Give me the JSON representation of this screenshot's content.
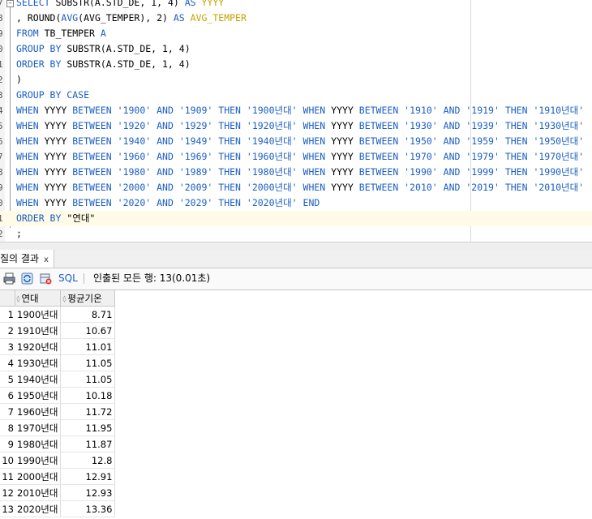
{
  "editor": {
    "lines": [
      {
        "ln": "7",
        "tokens": [
          [
            "kw",
            "SELECT "
          ],
          [
            "fn",
            "SUBSTR(A.STD_DE, 1, 4) "
          ],
          [
            "kw",
            "AS "
          ],
          [
            "alias",
            "YYYY"
          ]
        ]
      },
      {
        "ln": "8",
        "tokens": [
          [
            "ident",
            ", ROUND("
          ],
          [
            "kw",
            "AVG"
          ],
          [
            "ident",
            "(AVG_TEMPER), 2) "
          ],
          [
            "kw",
            "AS "
          ],
          [
            "alias",
            "AVG_TEMPER"
          ]
        ]
      },
      {
        "ln": "9",
        "tokens": [
          [
            "kw",
            "FROM "
          ],
          [
            "ident",
            "TB_TEMPER "
          ],
          [
            "kw",
            "A"
          ]
        ]
      },
      {
        "ln": "0",
        "tokens": [
          [
            "kw",
            "GROUP BY "
          ],
          [
            "ident",
            "SUBSTR(A.STD_DE, 1, 4)"
          ]
        ]
      },
      {
        "ln": "1",
        "tokens": [
          [
            "kw",
            "ORDER BY "
          ],
          [
            "ident",
            "SUBSTR(A.STD_DE, 1, 4)"
          ]
        ]
      },
      {
        "ln": "2",
        "tokens": [
          [
            "ident",
            ")"
          ]
        ]
      },
      {
        "ln": "3",
        "tokens": [
          [
            "kw",
            "GROUP BY CASE"
          ]
        ]
      },
      {
        "ln": "4",
        "tokens": [
          [
            "kw",
            "WHEN "
          ],
          [
            "ident",
            "YYYY "
          ],
          [
            "kw",
            "BETWEEN "
          ],
          [
            "str",
            "'1900' "
          ],
          [
            "kw",
            "AND "
          ],
          [
            "str",
            "'1909' "
          ],
          [
            "kw",
            "THEN "
          ],
          [
            "str",
            "'1900년대' "
          ],
          [
            "kw",
            "WHEN "
          ],
          [
            "ident",
            "YYYY "
          ],
          [
            "kw",
            "BETWEEN "
          ],
          [
            "str",
            "'1910' "
          ],
          [
            "kw",
            "AND "
          ],
          [
            "str",
            "'1919' "
          ],
          [
            "kw",
            "THEN "
          ],
          [
            "str",
            "'1910년대'"
          ]
        ]
      },
      {
        "ln": "5",
        "tokens": [
          [
            "kw",
            "WHEN "
          ],
          [
            "ident",
            "YYYY "
          ],
          [
            "kw",
            "BETWEEN "
          ],
          [
            "str",
            "'1920' "
          ],
          [
            "kw",
            "AND "
          ],
          [
            "str",
            "'1929' "
          ],
          [
            "kw",
            "THEN "
          ],
          [
            "str",
            "'1920년대' "
          ],
          [
            "kw",
            "WHEN "
          ],
          [
            "ident",
            "YYYY "
          ],
          [
            "kw",
            "BETWEEN "
          ],
          [
            "str",
            "'1930' "
          ],
          [
            "kw",
            "AND "
          ],
          [
            "str",
            "'1939' "
          ],
          [
            "kw",
            "THEN "
          ],
          [
            "str",
            "'1930년대'"
          ]
        ]
      },
      {
        "ln": "6",
        "tokens": [
          [
            "kw",
            "WHEN "
          ],
          [
            "ident",
            "YYYY "
          ],
          [
            "kw",
            "BETWEEN "
          ],
          [
            "str",
            "'1940' "
          ],
          [
            "kw",
            "AND "
          ],
          [
            "str",
            "'1949' "
          ],
          [
            "kw",
            "THEN "
          ],
          [
            "str",
            "'1940년대' "
          ],
          [
            "kw",
            "WHEN "
          ],
          [
            "ident",
            "YYYY "
          ],
          [
            "kw",
            "BETWEEN "
          ],
          [
            "str",
            "'1950' "
          ],
          [
            "kw",
            "AND "
          ],
          [
            "str",
            "'1959' "
          ],
          [
            "kw",
            "THEN "
          ],
          [
            "str",
            "'1950년대'"
          ]
        ]
      },
      {
        "ln": "7",
        "tokens": [
          [
            "kw",
            "WHEN "
          ],
          [
            "ident",
            "YYYY "
          ],
          [
            "kw",
            "BETWEEN "
          ],
          [
            "str",
            "'1960' "
          ],
          [
            "kw",
            "AND "
          ],
          [
            "str",
            "'1969' "
          ],
          [
            "kw",
            "THEN "
          ],
          [
            "str",
            "'1960년대' "
          ],
          [
            "kw",
            "WHEN "
          ],
          [
            "ident",
            "YYYY "
          ],
          [
            "kw",
            "BETWEEN "
          ],
          [
            "str",
            "'1970' "
          ],
          [
            "kw",
            "AND "
          ],
          [
            "str",
            "'1979' "
          ],
          [
            "kw",
            "THEN "
          ],
          [
            "str",
            "'1970년대'"
          ]
        ]
      },
      {
        "ln": "8",
        "tokens": [
          [
            "kw",
            "WHEN "
          ],
          [
            "ident",
            "YYYY "
          ],
          [
            "kw",
            "BETWEEN "
          ],
          [
            "str",
            "'1980' "
          ],
          [
            "kw",
            "AND "
          ],
          [
            "str",
            "'1989' "
          ],
          [
            "kw",
            "THEN "
          ],
          [
            "str",
            "'1980년대' "
          ],
          [
            "kw",
            "WHEN "
          ],
          [
            "ident",
            "YYYY "
          ],
          [
            "kw",
            "BETWEEN "
          ],
          [
            "str",
            "'1990' "
          ],
          [
            "kw",
            "AND "
          ],
          [
            "str",
            "'1999' "
          ],
          [
            "kw",
            "THEN "
          ],
          [
            "str",
            "'1990년대'"
          ]
        ]
      },
      {
        "ln": "9",
        "tokens": [
          [
            "kw",
            "WHEN "
          ],
          [
            "ident",
            "YYYY "
          ],
          [
            "kw",
            "BETWEEN "
          ],
          [
            "str",
            "'2000' "
          ],
          [
            "kw",
            "AND "
          ],
          [
            "str",
            "'2009' "
          ],
          [
            "kw",
            "THEN "
          ],
          [
            "str",
            "'2000년대' "
          ],
          [
            "kw",
            "WHEN "
          ],
          [
            "ident",
            "YYYY "
          ],
          [
            "kw",
            "BETWEEN "
          ],
          [
            "str",
            "'2010' "
          ],
          [
            "kw",
            "AND "
          ],
          [
            "str",
            "'2019' "
          ],
          [
            "kw",
            "THEN "
          ],
          [
            "str",
            "'2010년대'"
          ]
        ]
      },
      {
        "ln": "0",
        "tokens": [
          [
            "kw",
            "WHEN "
          ],
          [
            "ident",
            "YYYY "
          ],
          [
            "kw",
            "BETWEEN "
          ],
          [
            "str",
            "'2020' "
          ],
          [
            "kw",
            "AND "
          ],
          [
            "str",
            "'2029' "
          ],
          [
            "kw",
            "THEN "
          ],
          [
            "str",
            "'2020년대' "
          ],
          [
            "kw",
            "END"
          ]
        ]
      },
      {
        "ln": "1",
        "tokens": [
          [
            "kw",
            "ORDER BY "
          ],
          [
            "ident",
            "\"연대\""
          ]
        ],
        "current": true
      },
      {
        "ln": "2",
        "tokens": [
          [
            "ident",
            ";"
          ]
        ]
      }
    ]
  },
  "results_tab": {
    "label": "질의 결과",
    "close": "x"
  },
  "toolbar": {
    "sql_label": "SQL",
    "status": "인출된 모든 행: 13(0.01초)"
  },
  "grid": {
    "columns": [
      "연대",
      "평균기온"
    ],
    "rows": [
      [
        "1",
        "1900년대",
        "8.71"
      ],
      [
        "2",
        "1910년대",
        "10.67"
      ],
      [
        "3",
        "1920년대",
        "11.01"
      ],
      [
        "4",
        "1930년대",
        "11.05"
      ],
      [
        "5",
        "1940년대",
        "11.05"
      ],
      [
        "6",
        "1950년대",
        "10.18"
      ],
      [
        "7",
        "1960년대",
        "11.72"
      ],
      [
        "8",
        "1970년대",
        "11.95"
      ],
      [
        "9",
        "1980년대",
        "11.87"
      ],
      [
        "10",
        "1990년대",
        "12.8"
      ],
      [
        "11",
        "2000년대",
        "12.91"
      ],
      [
        "12",
        "2010년대",
        "12.93"
      ],
      [
        "13",
        "2020년대",
        "13.36"
      ]
    ]
  }
}
